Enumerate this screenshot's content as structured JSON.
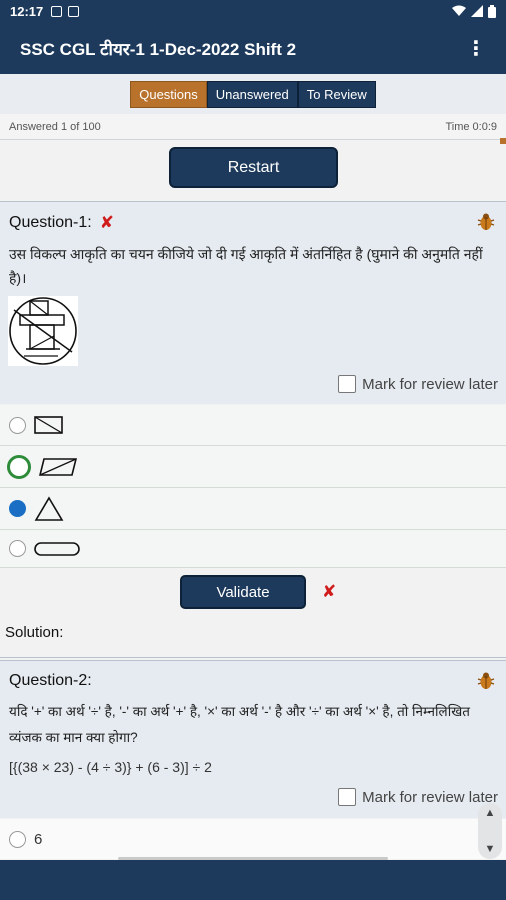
{
  "status": {
    "time": "12:17"
  },
  "app": {
    "title": "SSC CGL टीयर-1 1-Dec-2022 Shift 2",
    "menu_icon": "⋮"
  },
  "tabs": [
    {
      "label": "Questions",
      "active": true
    },
    {
      "label": "Unanswered",
      "active": false
    },
    {
      "label": "To Review",
      "active": false
    }
  ],
  "info": {
    "answered": "Answered 1 of 100",
    "time": "Time 0:0:9"
  },
  "restart_label": "Restart",
  "question1": {
    "label": "Question-1:",
    "result_icon": "✘",
    "text": "उस विकल्प आकृति का चयन कीजिये जो दी गई आकृति में अंतर्निहित है (घुमाने की अनुमति नहीं है)।",
    "review_label": "Mark for review later",
    "options": [
      {
        "shape": "rect-diagonal",
        "state": "empty"
      },
      {
        "shape": "parallelogram-diagonal",
        "state": "correct"
      },
      {
        "shape": "triangle",
        "state": "selected"
      },
      {
        "shape": "rounded-bar",
        "state": "empty"
      }
    ]
  },
  "validate_label": "Validate",
  "validate_result_icon": "✘",
  "solution_label": "Solution:",
  "question2": {
    "label": "Question-2:",
    "text": "यदि '+' का अर्थ '÷' है, '-' का अर्थ '+' है, '×' का अर्थ '-' है और '÷' का अर्थ '×' है, तो निम्नलिखित व्यंजक का मान क्या होगा?",
    "expression": "[{(38 × 23) - (4 ÷ 3)} + (6 - 3)] ÷ 2",
    "review_label": "Mark for review later",
    "first_option": "6"
  }
}
